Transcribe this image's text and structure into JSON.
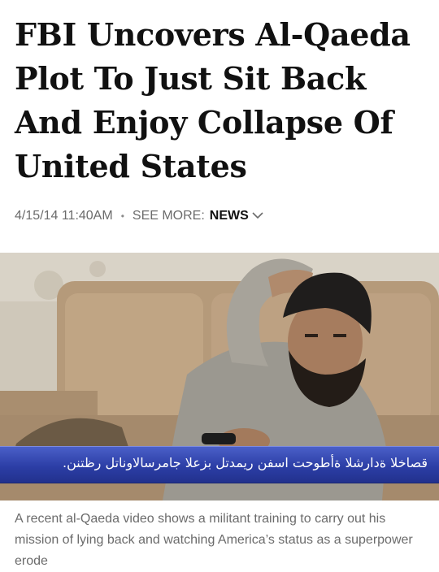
{
  "article": {
    "headline": "FBI Uncovers Al-Qaeda Plot To Just Sit Back And Enjoy Collapse Of United States",
    "timestamp": "4/15/14 11:40AM",
    "separator": "•",
    "see_more_label": "SEE MORE:",
    "category": "NEWS",
    "photo_overlay_text": "قصاخلا ةدارشلا ةأطوحت اسفن ريمدتل بزعلا جامرسالاوناتل رظتنن.",
    "photo_caption": "A recent al-Qaeda video shows a militant training to carry out his mission of lying back and watching America’s status as a superpower erode"
  },
  "icons": {
    "category_dropdown": "chevron-down-icon"
  },
  "colors": {
    "headline": "#111111",
    "meta": "#6b6b6b",
    "overlay_bar": "#2c3ea6"
  }
}
